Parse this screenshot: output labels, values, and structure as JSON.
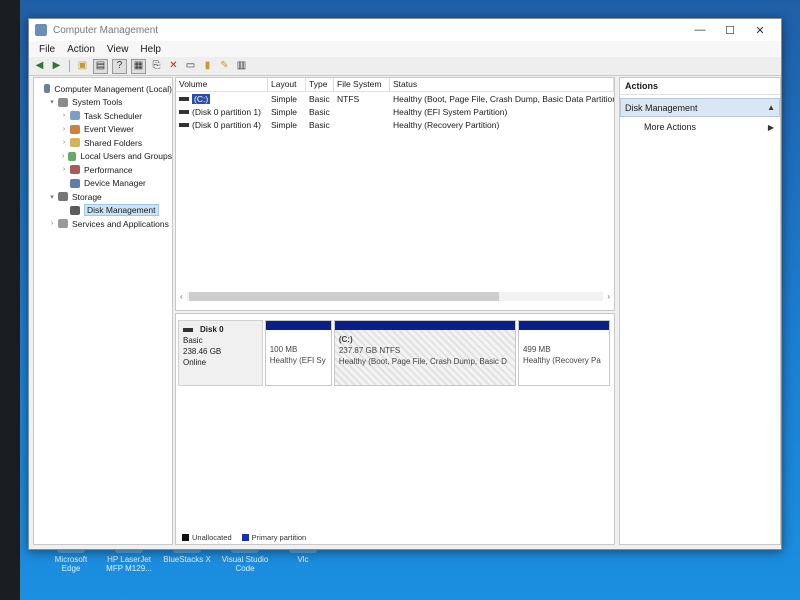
{
  "window": {
    "title": "Computer Management"
  },
  "menu": [
    "File",
    "Action",
    "View",
    "Help"
  ],
  "toolbar_icons": [
    "back-arrow-icon",
    "forward-arrow-icon",
    "up-folder-icon",
    "show-hide-tree-icon",
    "help-icon",
    "properties-icon",
    "connect-icon",
    "delete-icon",
    "export-icon",
    "refresh-icon",
    "help-topic-icon",
    "view-icon"
  ],
  "tree": [
    {
      "label": "Computer Management (Local)",
      "level": 0,
      "toggle": "",
      "icon": "computer-icon",
      "ic": "ic-comp"
    },
    {
      "label": "System Tools",
      "level": 1,
      "toggle": "▾",
      "icon": "tools-icon",
      "ic": "ic-tools"
    },
    {
      "label": "Task Scheduler",
      "level": 2,
      "toggle": "›",
      "icon": "clock-icon",
      "ic": "ic-clock"
    },
    {
      "label": "Event Viewer",
      "level": 2,
      "toggle": "›",
      "icon": "event-viewer-icon",
      "ic": "ic-event"
    },
    {
      "label": "Shared Folders",
      "level": 2,
      "toggle": "›",
      "icon": "shared-folder-icon",
      "ic": "ic-share"
    },
    {
      "label": "Local Users and Groups",
      "level": 2,
      "toggle": "›",
      "icon": "users-icon",
      "ic": "ic-users"
    },
    {
      "label": "Performance",
      "level": 2,
      "toggle": "›",
      "icon": "performance-icon",
      "ic": "ic-perf"
    },
    {
      "label": "Device Manager",
      "level": 2,
      "toggle": "",
      "icon": "device-manager-icon",
      "ic": "ic-dev"
    },
    {
      "label": "Storage",
      "level": 1,
      "toggle": "▾",
      "icon": "storage-icon",
      "ic": "ic-store"
    },
    {
      "label": "Disk Management",
      "level": 2,
      "toggle": "",
      "icon": "disk-icon",
      "ic": "ic-disk",
      "selected": true
    },
    {
      "label": "Services and Applications",
      "level": 1,
      "toggle": "›",
      "icon": "services-icon",
      "ic": "ic-svc"
    }
  ],
  "volumes": {
    "headers": [
      "Volume",
      "Layout",
      "Type",
      "File System",
      "Status"
    ],
    "rows": [
      {
        "volume": "(C:)",
        "layout": "Simple",
        "type": "Basic",
        "fs": "NTFS",
        "status": "Healthy (Boot, Page File, Crash Dump, Basic Data Partition)",
        "selected": true
      },
      {
        "volume": "(Disk 0 partition 1)",
        "layout": "Simple",
        "type": "Basic",
        "fs": "",
        "status": "Healthy (EFI System Partition)"
      },
      {
        "volume": "(Disk 0 partition 4)",
        "layout": "Simple",
        "type": "Basic",
        "fs": "",
        "status": "Healthy (Recovery Partition)"
      }
    ]
  },
  "disk": {
    "name": "Disk 0",
    "type": "Basic",
    "size": "238.46 GB",
    "state": "Online",
    "partitions": [
      {
        "key": "efi",
        "letter": "",
        "size": "100 MB",
        "status": "Healthy (EFI Sy"
      },
      {
        "key": "c",
        "letter": "(C:)",
        "size": "237.87 GB NTFS",
        "status": "Healthy (Boot, Page File, Crash Dump, Basic D"
      },
      {
        "key": "rec",
        "letter": "",
        "size": "499 MB",
        "status": "Healthy (Recovery Pa"
      }
    ]
  },
  "legend": [
    {
      "label": "Unallocated",
      "color": "#111111"
    },
    {
      "label": "Primary partition",
      "color": "#1d2fa8"
    }
  ],
  "actions": {
    "header": "Actions",
    "section": "Disk Management",
    "items": [
      "More Actions"
    ]
  },
  "desktop_icons": [
    "Microsoft Edge",
    "HP LaserJet MFP M129...",
    "BlueStacks X",
    "Visual Studio Code",
    "Vlc"
  ]
}
